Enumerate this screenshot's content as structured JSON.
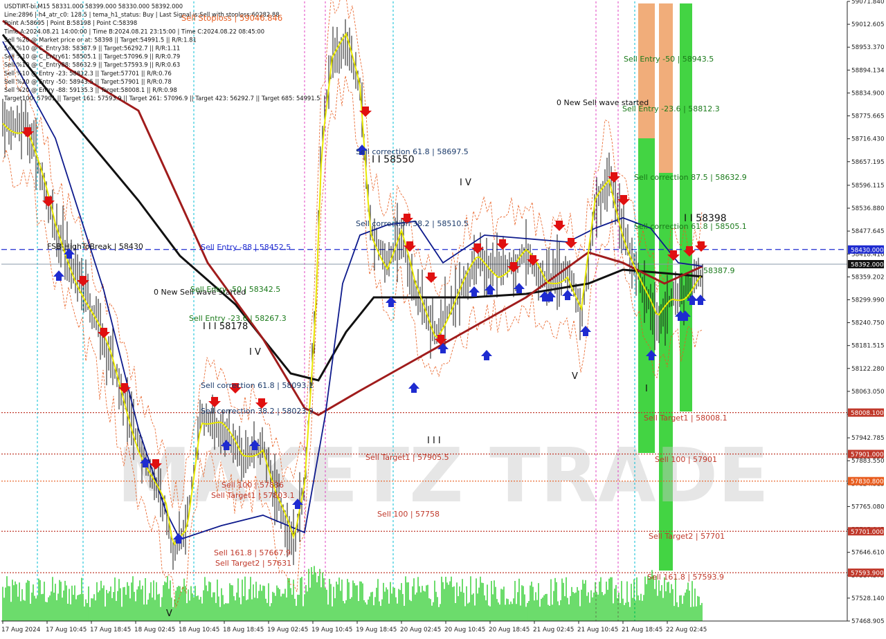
{
  "header": {
    "lines": [
      "USDTIRT-bi,M15  58331.000 58399.000 58330.000 58392.000",
      "Line:2896 | h4_atr_c0: 128.5 | tema_h1_status: Buy | Last Signal is:Sell with stoploss:60282.88",
      "Point A:58695 | Point B:58198 | Point C:58398",
      "Time A:2024.08.21 14:00:00 | Time B:2024.08.21 23:15:00 | Time C:2024.08.22 08:45:00",
      "Sell %20 @ Market price or at: 58398 || Target:54991.5 || R/R:1.81",
      "Sell %10 @ C_Entry38: 58387.9 || Target:56292.7 || R/R:1.11",
      "Sell %10 @ C_Entry61: 58505.1 || Target:57096.9 || R/R:0.79",
      "Sell %10 @ C_Entry88: 58632.9 || Target:57593.9 || R/R:0.63",
      "Sell %10 @ Entry -23: 58812.3 || Target:57701 || R/R:0.76",
      "Sell %20 @ Entry -50: 58943.5 || Target:57901 || R/R:0.78",
      "Sell %20 @ Entry -88: 59135.3 || Target:58008.1 || R/R:0.98",
      "Target100: 57901 || Target 161: 57593.9 || Target 261: 57096.9 || Target 423: 56292.7 || Target 685: 54991.5"
    ],
    "stoploss_label": "Sell Stoploss | 59046.846"
  },
  "watermark": "MAKETZ TRADE",
  "chart_data": {
    "type": "candlestick",
    "symbol": "USDTIRT-bi",
    "timeframe": "M15",
    "ylim": [
      57468.905,
      59071.84
    ],
    "y_tick_labels": [
      "59071.840",
      "59012.605",
      "58953.370",
      "58894.134",
      "58834.900",
      "58775.665",
      "58716.430",
      "58657.195",
      "58596.115",
      "58536.880",
      "58477.645",
      "58418.410",
      "58359.202",
      "58299.990",
      "58240.750",
      "58181.515",
      "58122.280",
      "58063.050",
      "58003.815",
      "57942.785",
      "57883.550",
      "57824.315",
      "57765.080",
      "57705.845",
      "57646.610",
      "57587.375",
      "57528.140",
      "57468.905"
    ],
    "x_tick_labels": [
      "17 Aug 2024",
      "17 Aug 10:45",
      "17 Aug 18:45",
      "18 Aug 02:45",
      "18 Aug 10:45",
      "18 Aug 18:45",
      "19 Aug 02:45",
      "19 Aug 10:45",
      "19 Aug 18:45",
      "20 Aug 02:45",
      "20 Aug 10:45",
      "20 Aug 18:45",
      "21 Aug 02:45",
      "21 Aug 10:45",
      "21 Aug 18:45",
      "22 Aug 02:45"
    ],
    "price_tags": [
      {
        "label": "58430.000",
        "value": 58430,
        "color": "#1e2bd0"
      },
      {
        "label": "58392.000",
        "value": 58392,
        "color": "#111111"
      },
      {
        "label": "58008.100",
        "value": 58008.1,
        "color": "#c0392b"
      },
      {
        "label": "57901.000",
        "value": 57901,
        "color": "#c0392b"
      },
      {
        "label": "57830.800",
        "value": 57830.8,
        "color": "#e85c1e"
      },
      {
        "label": "57701.000",
        "value": 57701,
        "color": "#c0392b"
      },
      {
        "label": "57593.900",
        "value": 57593.9,
        "color": "#c0392b"
      }
    ],
    "levels": [
      {
        "value": 58430,
        "color": "#1e2bd0",
        "style": "dashed"
      },
      {
        "value": 58392,
        "color": "#8899aa",
        "style": "solid"
      },
      {
        "value": 58008.1,
        "color": "#c0392b",
        "style": "dotted"
      },
      {
        "value": 57901,
        "color": "#c0392b",
        "style": "dotted"
      },
      {
        "value": 57830.8,
        "color": "#e85c1e",
        "style": "dotted"
      },
      {
        "value": 57701,
        "color": "#c0392b",
        "style": "dotted"
      },
      {
        "value": 57593.9,
        "color": "#c0392b",
        "style": "dotted"
      }
    ],
    "annotations": [
      {
        "text": "Sell Entry -50 | 58943.5",
        "color": "#1a7a1a"
      },
      {
        "text": "Sell Entry -23.6 | 58812.3",
        "color": "#1a7a1a"
      },
      {
        "text": "0 New Sell wave started",
        "color": "#111111"
      },
      {
        "text": "Sell correction 61.8 | 58697.5",
        "color": "#1a3a6a"
      },
      {
        "text": "I I 58550",
        "color": "#111111"
      },
      {
        "text": "I V",
        "color": "#111111"
      },
      {
        "text": "Sell correction 87.5 | 58632.9",
        "color": "#1a7a1a"
      },
      {
        "text": "I I 58398",
        "color": "#111111"
      },
      {
        "text": "Sell correction 61.8 | 58505.1",
        "color": "#1a7a1a"
      },
      {
        "text": "Sell correction 38.2 | 58510.5",
        "color": "#1a3a6a"
      },
      {
        "text": "FSB-HighToBreak | 58430",
        "color": "#111111"
      },
      {
        "text": "Sell Entry -88 | 58452.5",
        "color": "#1e2bd0"
      },
      {
        "text": "58387.9",
        "color": "#1a7a1a"
      },
      {
        "text": "0 New Sell wave started",
        "color": "#111111"
      },
      {
        "text": "Sell Entry -50 | 58342.5",
        "color": "#1a7a1a"
      },
      {
        "text": "Sell Entry -23.6 | 58267.3",
        "color": "#1a7a1a"
      },
      {
        "text": "I I I 58178",
        "color": "#111111"
      },
      {
        "text": "I V",
        "color": "#111111"
      },
      {
        "text": "Sell correction 61.8 | 58093.1",
        "color": "#1a3a6a"
      },
      {
        "text": "Sell correction 38.2 | 58023.9",
        "color": "#1a3a6a"
      },
      {
        "text": "V",
        "color": "#111111"
      },
      {
        "text": "I",
        "color": "#111111"
      },
      {
        "text": "Sell Target1 | 58008.1",
        "color": "#c0392b"
      },
      {
        "text": "I I I",
        "color": "#111111"
      },
      {
        "text": "Sell Target1 | 57905.5",
        "color": "#c0392b"
      },
      {
        "text": "Sell 100 | 57901",
        "color": "#c0392b"
      },
      {
        "text": "Sell 100 | 57836",
        "color": "#c0392b"
      },
      {
        "text": "Sell Target1 | 57803.1",
        "color": "#c0392b"
      },
      {
        "text": "Sell 100 | 57758",
        "color": "#c0392b"
      },
      {
        "text": "Sell Target2 | 57701",
        "color": "#c0392b"
      },
      {
        "text": "Sell 161.8 | 57667.9",
        "color": "#c0392b"
      },
      {
        "text": "Sell Target2 | 57631",
        "color": "#c0392b"
      },
      {
        "text": "Sell 161.8 | 57593.9",
        "color": "#c0392b"
      },
      {
        "text": "V",
        "color": "#111111"
      }
    ],
    "series": [
      {
        "name": "",
        "color": "#111111"
      },
      {
        "name": "",
        "color": "#a01c1c"
      },
      {
        "name": "",
        "color": "#0d1a8c"
      },
      {
        "name": "",
        "color": "#e8e800"
      },
      {
        "name": "",
        "color": "#e85c1e"
      }
    ],
    "volume_color": "#3ad13a",
    "zones": [
      {
        "color": "#e87722"
      },
      {
        "color": "#22cc22"
      }
    ]
  }
}
